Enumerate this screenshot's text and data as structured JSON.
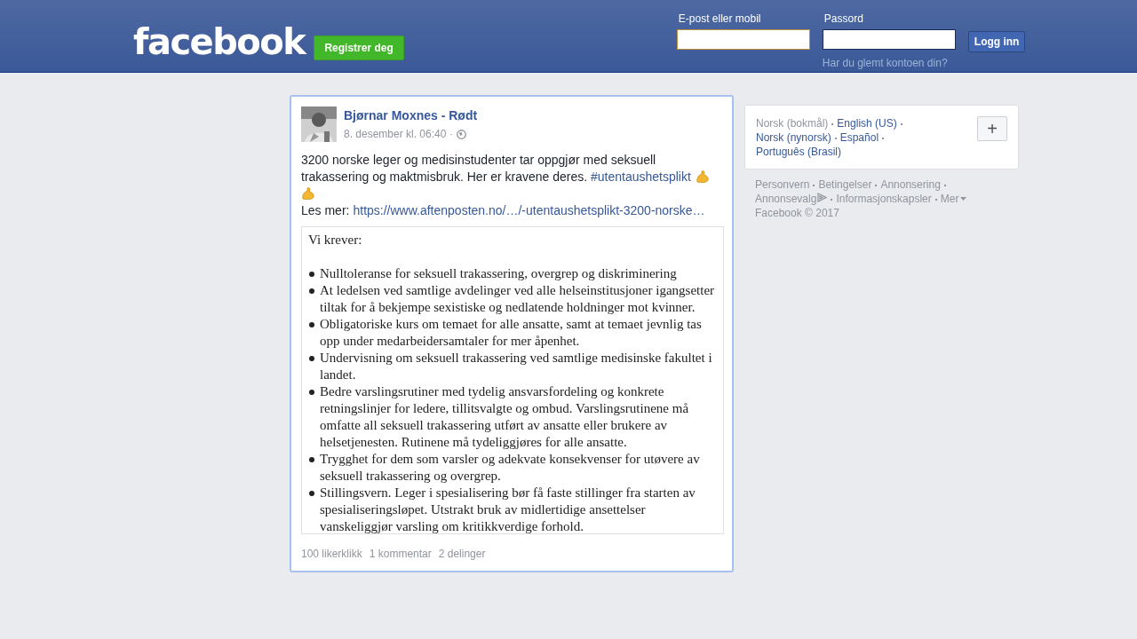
{
  "header": {
    "logo": "facebook",
    "register_button": "Registrer deg",
    "email_label": "E-post eller mobil",
    "password_label": "Passord",
    "login_button": "Logg inn",
    "forgot_link": "Har du glemt kontoen din?"
  },
  "post": {
    "author": "Bjørnar Moxnes - Rødt",
    "time": "8. desember kl. 06:40 ·",
    "text": "3200 norske leger og medisinstudenter tar oppgjør med seksuell trakassering og maktmisbruk. Her er kravene deres.",
    "hashtag": "#utentaushetsplikt",
    "more_label": "Les mer:",
    "link": "https://www.aftenposten.no/…/-utentaushetsplikt-3200-norske…",
    "document": {
      "heading": "Vi krever:",
      "items": [
        "Nulltoleranse for seksuell trakassering, overgrep og diskriminering",
        "At ledelsen ved samtlige avdelinger ved alle helseinstitusjoner igangsetter tiltak for å bekjempe sexistiske og nedlatende holdninger mot kvinner.",
        "Obligatoriske kurs om temaet for alle ansatte, samt at temaet jevnlig tas opp under medarbeidersamtaler for mer åpenhet.",
        "Undervisning om seksuell trakassering ved samtlige medisinske fakultet i landet.",
        "Bedre varslingsrutiner med tydelig ansvarsfordeling og konkrete retningslinjer for ledere, tillitsvalgte og ombud. Varslingsrutinene må omfatte all seksuell trakassering utført av ansatte eller brukere av helsetjenesten. Rutinene må tydeliggjøres for alle ansatte.",
        "Trygghet for dem som varsler og adekvate konsekvenser for utøvere av seksuell trakassering og overgrep.",
        "Stillingsvern. Leger i spesialisering bør få faste stillinger fra starten av spesialiseringsløpet. Utstrakt bruk av midlertidige ansettelser vanskeliggjør varsling om kritikkverdige forhold."
      ]
    },
    "stats": [
      "100 likerklikk",
      "1 kommentar",
      "2 delinger"
    ]
  },
  "languages": [
    {
      "label": "Norsk (bokmål)",
      "selected": true
    },
    {
      "label": "English (US)",
      "selected": false
    },
    {
      "label": "Norsk (nynorsk)",
      "selected": false
    },
    {
      "label": "Español",
      "selected": false
    },
    {
      "label": "Português (Brasil)",
      "selected": false
    }
  ],
  "add_language_button": "+",
  "footer_links": [
    "Personvern",
    "Betingelser",
    "Annonsering",
    "Annonsevalg",
    "Informasjonskapsler",
    "Mer"
  ],
  "copyright": "Facebook © 2017"
}
